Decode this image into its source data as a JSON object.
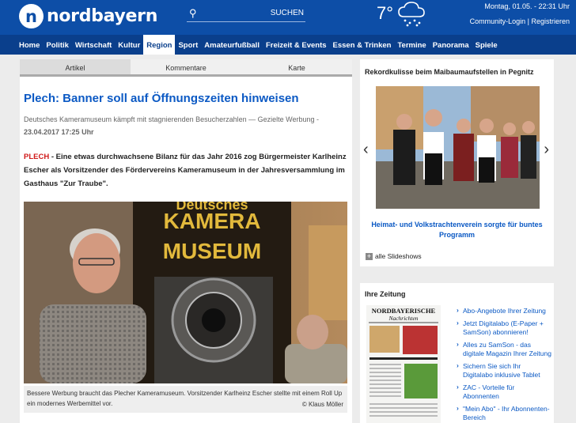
{
  "header": {
    "logo_text": "nordbayern",
    "search_button": "SUCHEN",
    "search_placeholder": "",
    "temperature": "7°",
    "weather_icon": "cloud-snow-icon",
    "date": "Montag, 01.05. - 22:31 Uhr",
    "login": "Community-Login",
    "register": "Registrieren"
  },
  "nav": [
    "Home",
    "Politik",
    "Wirtschaft",
    "Kultur",
    "Region",
    "Sport",
    "Amateurfußball",
    "Freizeit & Events",
    "Essen & Trinken",
    "Termine",
    "Panorama",
    "Spiele"
  ],
  "nav_active": "Region",
  "article": {
    "tabs": [
      "Artikel",
      "Kommentare",
      "Karte"
    ],
    "title": "Plech: Banner soll auf Öffnungszeiten hinweisen",
    "subline": "Deutsches Kameramuseum kämpft mit stagnierenden Besucherzahlen — Gezielte Werbung -",
    "timestamp": "23.04.2017 17:25 Uhr",
    "lead_place": "PLECH",
    "lead_text": " - Eine etwas durchwachsene Bilanz für das Jahr 2016 zog Bürgermeister Karlheinz Escher als Vorsitzender des Fördervereins Kameramuseum in der Jahresversammlung im Gasthaus \"Zur Traube\".",
    "banner_text": "KAMERA MUSEUM",
    "banner_top": "Deutsches",
    "caption": "Bessere Werbung braucht das Plecher Kameramuseum. Vorsitzender Karlheinz Escher stellte mit einem Roll Up ein modernes Werbemittel vor.",
    "credit": "© Klaus Möller"
  },
  "slideshow": {
    "heading": "Rekordkulisse beim Maibaumaufstellen in Pegnitz",
    "caption": "Heimat- und Volkstrachtenverein sorgte für buntes Programm",
    "all_label": "alle Slideshows"
  },
  "zeitung": {
    "heading": "Ihre Zeitung",
    "paper_title": "NORDBAYERISCHE",
    "paper_subtitle": "Nachrichten",
    "links": [
      "Abo-Angebote Ihrer Zeitung",
      "Jetzt Digitalabo (E-Paper + SamSon) abonnieren!",
      "Alles zu SamSon - das digitale Magazin Ihrer Zeitung",
      "Sichern Sie sich Ihr Digitalabo inklusive Tablet",
      "ZAC - Vorteile für Abonnenten",
      "\"Mein Abo\" - Ihr Abonnenten-Bereich"
    ]
  },
  "colors": {
    "header_blue": "#0d4ea7",
    "nav_blue": "#0a3f8c",
    "link_blue": "#0b59c4",
    "place_red": "#d01a1a"
  }
}
